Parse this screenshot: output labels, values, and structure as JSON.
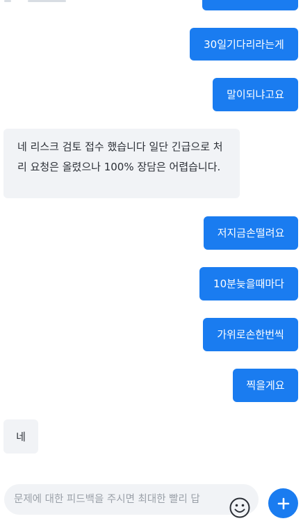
{
  "messages": [
    {
      "id": "m1",
      "side": "out",
      "text": "30일기다리라는게"
    },
    {
      "id": "m2",
      "side": "out",
      "text": "말이되냐고요"
    },
    {
      "id": "m3",
      "side": "in",
      "text": "네 리스크 검토 접수 했습니다 일단 긴급으로 처리 요청은 올렸으나 100% 장담은 어렵습니다."
    },
    {
      "id": "m4",
      "side": "out",
      "text": "저지금손떨려요"
    },
    {
      "id": "m5",
      "side": "out",
      "text": "10분늦을때마다"
    },
    {
      "id": "m6",
      "side": "out",
      "text": "가위로손한번씩"
    },
    {
      "id": "m7",
      "side": "out",
      "text": "찍을게요"
    },
    {
      "id": "m8",
      "side": "in",
      "text": "네"
    }
  ],
  "composer": {
    "placeholder": "문제에 대한 피드백을 주시면 최대한 빨리 답",
    "value": ""
  },
  "icons": {
    "emoji": "smiley-face-icon",
    "send": "plus-icon"
  },
  "colors": {
    "outgoing_bubble": "#1a7cf0",
    "incoming_bubble": "#f1f3f6",
    "accent": "#1a7cf0"
  }
}
